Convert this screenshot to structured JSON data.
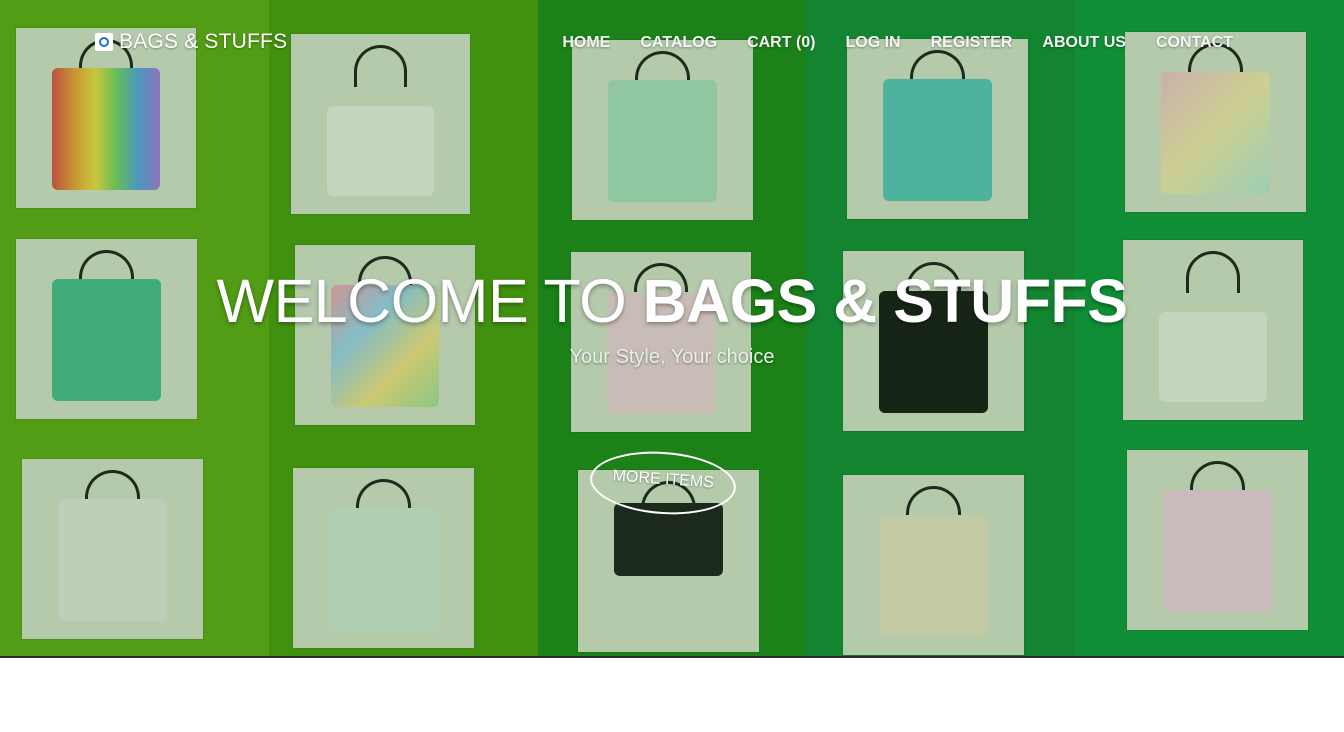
{
  "brand": {
    "name": "BAGS & STUFFS",
    "icon": "bag-logo-icon"
  },
  "nav": {
    "items": [
      {
        "label": "HOME"
      },
      {
        "label": "CATALOG"
      },
      {
        "label": "CART (0)"
      },
      {
        "label": "LOG IN"
      },
      {
        "label": "REGISTER"
      },
      {
        "label": "ABOUT US"
      },
      {
        "label": "CONTACT"
      }
    ]
  },
  "hero": {
    "headline_light": "WELCOME TO ",
    "headline_bold": "BAGS & STUFFS",
    "tagline": "Your Style, Your choice",
    "cta_label": "MORE ITEMS"
  },
  "theme": {
    "stripes": [
      "#62ad18",
      "#4d9e12",
      "#1f8a1c",
      "#158f3a",
      "#129a40"
    ]
  }
}
